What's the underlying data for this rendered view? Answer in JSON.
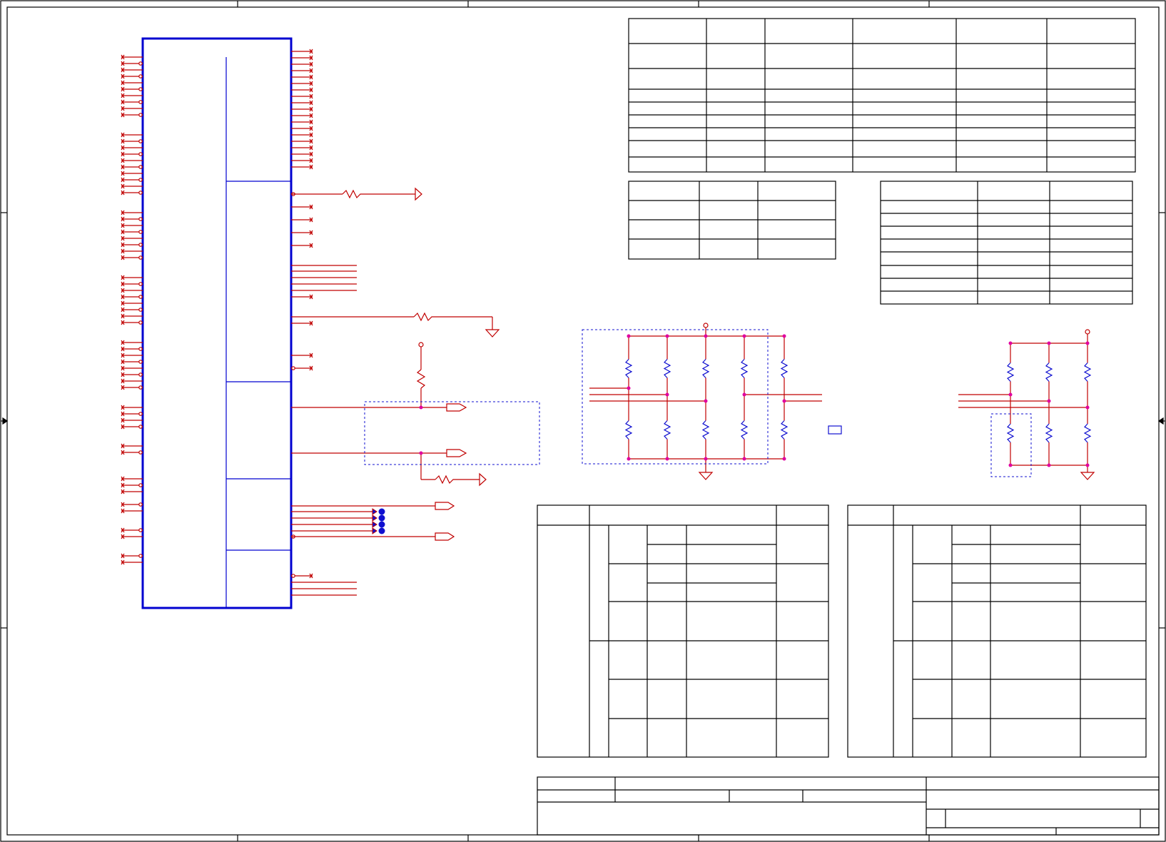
{
  "colors": {
    "background": "#ffffff",
    "frame": "#000000",
    "wire": "#c00000",
    "junction": "#e000a0",
    "component": "#0000d0",
    "net_marker": "#1010d0"
  }
}
